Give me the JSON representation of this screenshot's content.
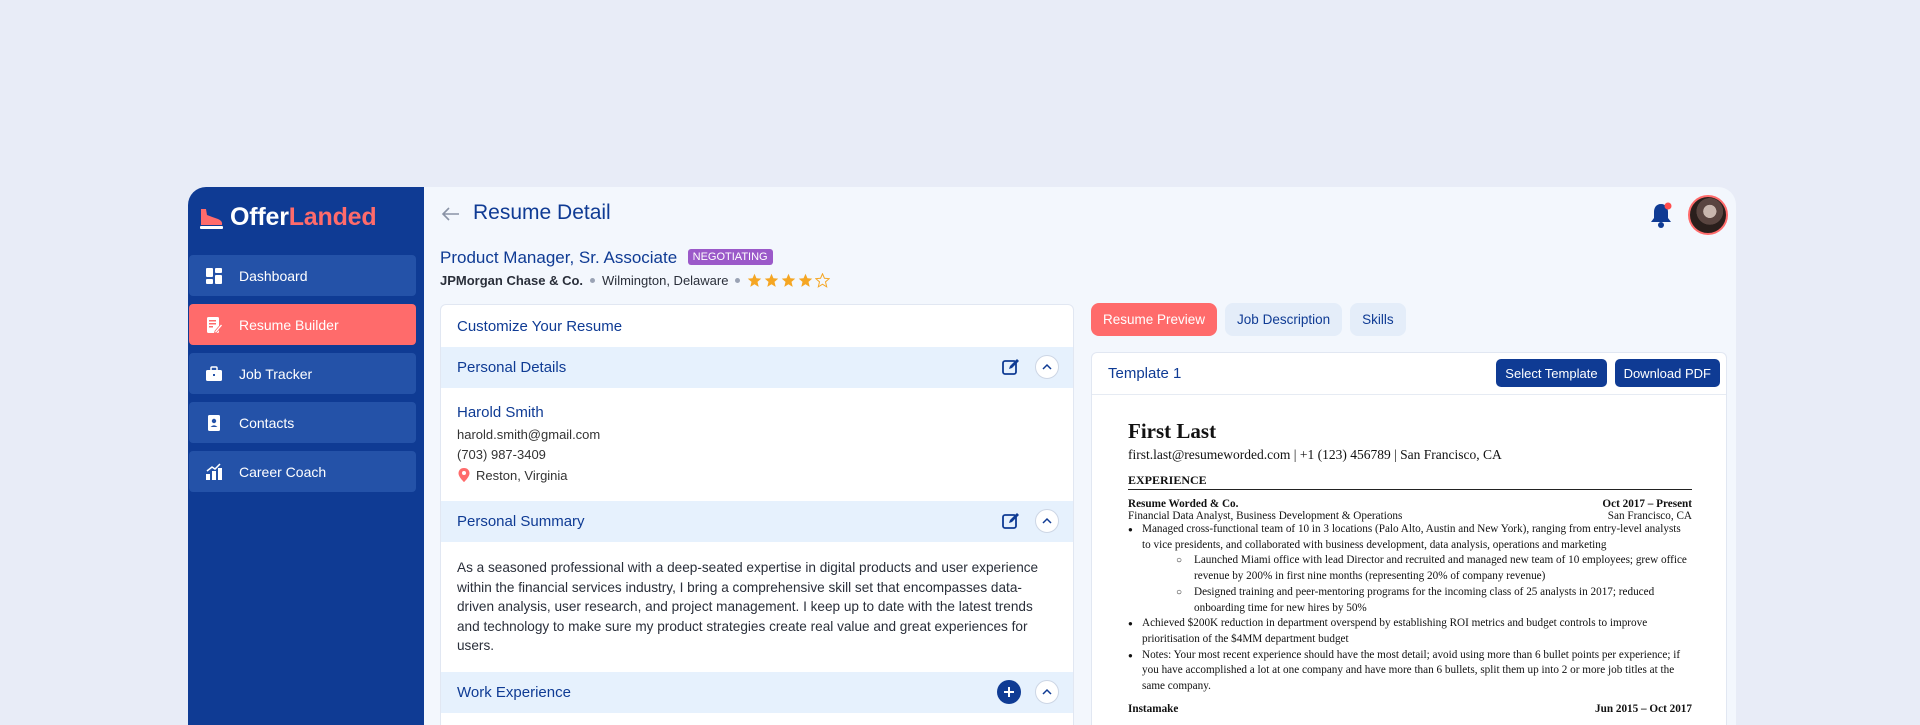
{
  "brand": {
    "name_part1": "Offer",
    "name_part2": "Landed",
    "accent": "#ff6b6b",
    "primary": "#0f3b94"
  },
  "sidebar": {
    "items": [
      {
        "label": "Dashboard",
        "icon": "dashboard-icon"
      },
      {
        "label": "Resume Builder",
        "icon": "resume-icon",
        "active": true
      },
      {
        "label": "Job Tracker",
        "icon": "briefcase-icon"
      },
      {
        "label": "Contacts",
        "icon": "contacts-icon"
      },
      {
        "label": "Career Coach",
        "icon": "career-coach-icon"
      }
    ]
  },
  "header": {
    "title": "Resume Detail"
  },
  "job": {
    "title": "Product Manager, Sr. Associate",
    "status": "NEGOTIATING",
    "company": "JPMorgan Chase & Co.",
    "location": "Wilmington, Delaware",
    "rating": 4,
    "rating_max": 5
  },
  "customize": {
    "heading": "Customize Your Resume",
    "personal_details": {
      "heading": "Personal Details",
      "name": "Harold Smith",
      "email": "harold.smith@gmail.com",
      "phone": "(703) 987-3409",
      "location": "Reston, Virginia"
    },
    "personal_summary": {
      "heading": "Personal Summary",
      "text": "As a seasoned professional with a deep-seated expertise in digital products and user experience within the financial services industry, I bring a comprehensive skill set that encompasses data-driven analysis, user research, and project management. I keep up to date with the latest trends and technology to make sure my product strategies create real value and great experiences for users."
    },
    "work_experience": {
      "heading": "Work Experience"
    }
  },
  "tabs": [
    {
      "label": "Resume Preview",
      "active": true
    },
    {
      "label": "Job Description"
    },
    {
      "label": "Skills"
    }
  ],
  "preview": {
    "template": "Template 1",
    "select_label": "Select Template",
    "download_label": "Download PDF",
    "doc": {
      "name": "First Last",
      "contact": "first.last@resumeworded.com | +1 (123) 456789 | San Francisco, CA",
      "section": "EXPERIENCE",
      "company": "Resume Worded & Co.",
      "dates": "Oct 2017 – Present",
      "role": "Financial Data Analyst, Business Development & Operations",
      "city": "San Francisco, CA",
      "bullet1": "Managed cross-functional team of 10 in 3 locations (Palo Alto, Austin and New York), ranging from entry-level analysts to vice presidents, and collaborated with business development, data analysis, operations and marketing",
      "sub1": "Launched Miami office with lead Director and recruited and managed new team of 10 employees; grew office revenue by 200% in first nine months (representing 20% of company revenue)",
      "sub2": "Designed training and peer-mentoring programs for the incoming class of 25 analysts in 2017; reduced onboarding time for new hires by 50%",
      "bullet2": "Achieved $200K reduction in department overspend by establishing ROI metrics and budget controls to improve prioritisation of the $4MM department budget",
      "bullet3": "Notes: Your most recent experience should have the most detail; avoid using more than 6 bullet points per experience; if you have accomplished a lot at one company and have more than 6 bullets, split them up into 2 or more job titles at the same company.",
      "next_company": "Instamake",
      "next_dates": "Jun 2015 – Oct 2017"
    }
  }
}
